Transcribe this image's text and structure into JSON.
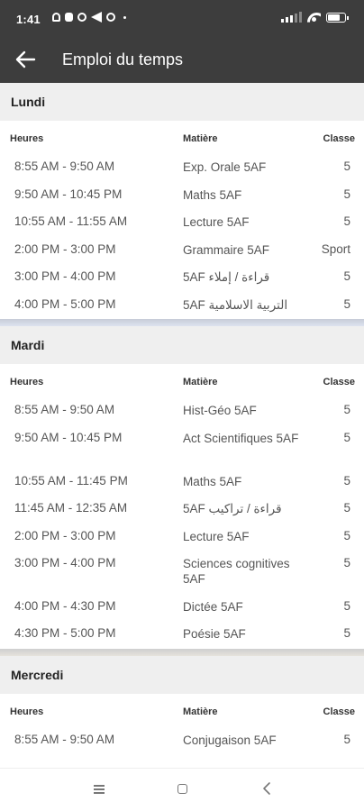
{
  "status_bar": {
    "time": "1:41",
    "icons": [
      "bell-icon",
      "cat-icon",
      "whatsapp-icon",
      "send-icon",
      "messenger-icon",
      "dot-icon",
      "signal-icon",
      "wifi-icon",
      "battery-icon"
    ]
  },
  "app_bar": {
    "title": "Emploi du temps",
    "back_icon": "arrow-left-icon"
  },
  "columns": {
    "heures": "Heures",
    "matiere": "Matière",
    "classe": "Classe"
  },
  "days": [
    {
      "name": "Lundi",
      "rows": [
        {
          "time": "8:55 AM - 9:50 AM",
          "subject": "Exp. Orale 5AF",
          "classe": "5"
        },
        {
          "time": "9:50 AM - 10:45 PM",
          "subject": "Maths 5AF",
          "classe": "5"
        },
        {
          "time": "10:55 AM - 11:55 AM",
          "subject": "Lecture 5AF",
          "classe": "5"
        },
        {
          "time": "2:00 PM - 3:00 PM",
          "subject": "Grammaire 5AF",
          "classe": "Sport"
        },
        {
          "time": "3:00 PM - 4:00 PM",
          "subject": "5AF قراءة / إملاء",
          "classe": "5"
        },
        {
          "time": "4:00 PM - 5:00 PM",
          "subject": "5AF التربية الاسلامية",
          "classe": "5"
        }
      ]
    },
    {
      "name": "Mardi",
      "rows": [
        {
          "time": "8:55 AM - 9:50 AM",
          "subject": "Hist-Géo 5AF",
          "classe": "5"
        },
        {
          "time": "9:50 AM - 10:45 PM",
          "subject": "Act Scientifiques 5AF",
          "classe": "5"
        },
        {
          "time": "10:55 AM - 11:45 PM",
          "subject": "Maths 5AF",
          "classe": "5"
        },
        {
          "time": "11:45 AM - 12:35 AM",
          "subject": "5AF قراءة / تراكيب",
          "classe": "5"
        },
        {
          "time": "2:00 PM - 3:00 PM",
          "subject": "Lecture 5AF",
          "classe": "5"
        },
        {
          "time": "3:00 PM - 4:00 PM",
          "subject": "Sciences cognitives 5AF",
          "classe": "5"
        },
        {
          "time": "4:00 PM - 4:30 PM",
          "subject": "Dictée 5AF",
          "classe": "5"
        },
        {
          "time": "4:30 PM - 5:00 PM",
          "subject": "Poésie 5AF",
          "classe": "5"
        }
      ]
    },
    {
      "name": "Mercredi",
      "rows": [
        {
          "time": "8:55 AM - 9:50 AM",
          "subject": "Conjugaison 5AF",
          "classe": "5"
        }
      ]
    }
  ],
  "nav_bar": {
    "icons": [
      "menu-icon",
      "home-icon",
      "back-icon"
    ]
  }
}
